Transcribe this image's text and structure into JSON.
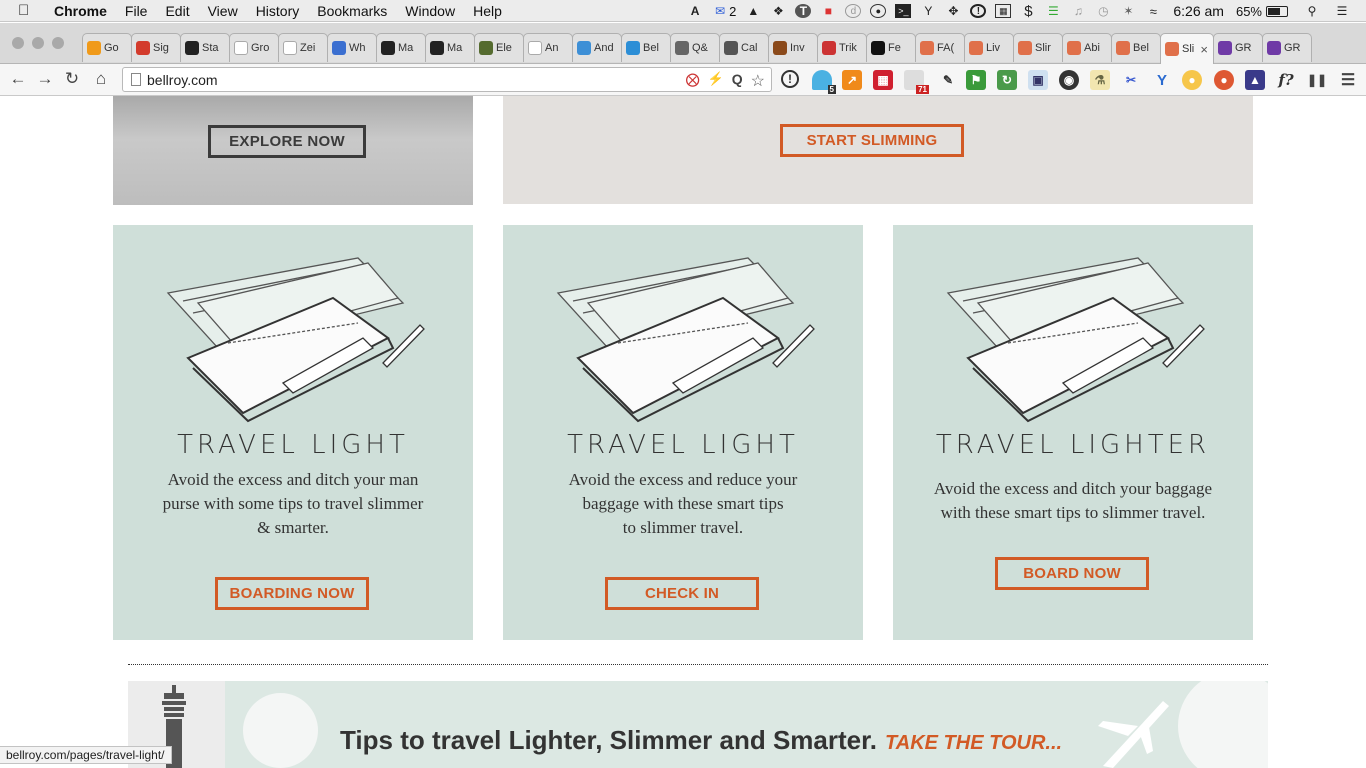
{
  "menubar": {
    "app": "Chrome",
    "items": [
      "File",
      "Edit",
      "View",
      "History",
      "Bookmarks",
      "Window",
      "Help"
    ],
    "mail_count": "2",
    "clock": "6:26 am",
    "battery": "65%"
  },
  "tabs": [
    {
      "label": "Go",
      "icon": "chart-icon",
      "color": "#f09a1a"
    },
    {
      "label": "Sig",
      "icon": "gmail-icon",
      "color": "#d33b2c"
    },
    {
      "label": "Sta",
      "icon": "github-icon",
      "color": "#222222"
    },
    {
      "label": "Gro",
      "icon": "wikipedia-icon",
      "color": "#ffffff"
    },
    {
      "label": "Zei",
      "icon": "wikipedia-icon",
      "color": "#ffffff"
    },
    {
      "label": "Wh",
      "icon": "globe-icon",
      "color": "#3b6fd0"
    },
    {
      "label": "Ma",
      "icon": "github-icon",
      "color": "#222222"
    },
    {
      "label": "Ma",
      "icon": "github-icon",
      "color": "#222222"
    },
    {
      "label": "Ele",
      "icon": "book-icon",
      "color": "#556b2f"
    },
    {
      "label": "An",
      "icon": "page-icon",
      "color": "#ffffff"
    },
    {
      "label": "And",
      "icon": "android-icon",
      "color": "#3d8fd6"
    },
    {
      "label": "Bel",
      "icon": "wordpress-icon",
      "color": "#2c8ed6"
    },
    {
      "label": "Q&",
      "icon": "qa-icon",
      "color": "#666666"
    },
    {
      "label": "Cal",
      "icon": "calendar-icon",
      "color": "#555555"
    },
    {
      "label": "Inv",
      "icon": "box-icon",
      "color": "#8b4a1b"
    },
    {
      "label": "Trik",
      "icon": "bike-icon",
      "color": "#cc3333"
    },
    {
      "label": "Fe",
      "icon": "a-logo-icon",
      "color": "#111111"
    },
    {
      "label": "FA(",
      "icon": "tag-icon",
      "color": "#e0704a"
    },
    {
      "label": "Liv",
      "icon": "tag-icon",
      "color": "#e0704a"
    },
    {
      "label": "Slir",
      "icon": "tag-icon",
      "color": "#e0704a"
    },
    {
      "label": "Abi",
      "icon": "tag-icon",
      "color": "#e0704a"
    },
    {
      "label": "Bel",
      "icon": "tag-icon",
      "color": "#e0704a"
    },
    {
      "label": "Sli",
      "icon": "tag-icon",
      "color": "#e0704a",
      "active": true
    },
    {
      "label": "GR",
      "icon": "b-logo-icon",
      "color": "#6f3aa6"
    },
    {
      "label": "GR",
      "icon": "b-logo-icon",
      "color": "#6f3aa6"
    }
  ],
  "toolbar": {
    "url": "bellroy.com",
    "extension_badges": {
      "ghostery": "5",
      "calendar": "71"
    }
  },
  "page": {
    "top_left_button": "EXPLORE NOW",
    "top_right_button": "START SLIMMING",
    "cards": [
      {
        "title": "TRAVEL LIGHT",
        "lines": [
          "Avoid the excess and ditch your man",
          "purse with some tips to travel slimmer",
          "& smarter."
        ],
        "button": "BOARDING NOW"
      },
      {
        "title": "TRAVEL LIGHT",
        "lines": [
          "Avoid the excess and reduce your",
          "baggage with these smart tips",
          "to slimmer travel."
        ],
        "button": "CHECK IN"
      },
      {
        "title": "TRAVEL LIGHTER",
        "lines": [
          "Avoid the excess and ditch your baggage",
          "with these smart tips to slimmer travel."
        ],
        "button": "BOARD NOW"
      }
    ],
    "banner": {
      "text": "Tips to travel Lighter, Slimmer and Smarter.",
      "cta": "TAKE THE TOUR..."
    }
  },
  "statusbar": {
    "link": "bellroy.com/pages/travel-light/"
  },
  "colors": {
    "accent": "#d25a25",
    "card_bg": "#cfdfd9",
    "panel_bg": "#e3e0dd"
  }
}
